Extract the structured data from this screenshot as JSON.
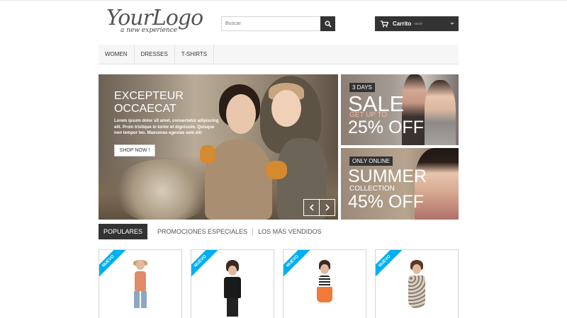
{
  "header": {
    "logo": {
      "main": "YourLogo",
      "tagline": "a new experience"
    },
    "search": {
      "placeholder": "Buscar",
      "button_icon": "search-icon"
    },
    "cart": {
      "label": "Carrito",
      "status": "vacío",
      "icon": "cart-icon"
    }
  },
  "nav": {
    "items": [
      {
        "label": "WOMEN"
      },
      {
        "label": "DRESSES"
      },
      {
        "label": "T-SHIRTS"
      }
    ]
  },
  "slider": {
    "title": "EXCEPTEUR OCCAECAT",
    "text": "Lorem ipsum dolor sit amet, consectetur adipiscing elit. Proin tristique in tortor et dignissim. Quisque non tempor leo. Maecenas egestas sem elit",
    "button": "SHOP NOW !",
    "prev_icon": "chevron-left-icon",
    "next_icon": "chevron-right-icon"
  },
  "banners": [
    {
      "tag": "3 DAYS",
      "line1": "SALE",
      "line2": "GET UP TO",
      "line3": "25% OFF"
    },
    {
      "tag": "ONLY ONLINE",
      "line1": "SUMMER",
      "line2": "COLLECTION",
      "line3": "45% OFF"
    }
  ],
  "tabs": [
    {
      "label": "POPULARES",
      "active": true
    },
    {
      "label": "PROMOCIONES ESPECIALES",
      "active": false
    },
    {
      "label": "LOS MÁS VENDIDOS",
      "active": false
    }
  ],
  "products": [
    {
      "badge": "NUEVO"
    },
    {
      "badge": "NUEVO"
    },
    {
      "badge": "NUEVO"
    },
    {
      "badge": "NUEVO"
    }
  ],
  "colors": {
    "dark": "#333333",
    "accent": "#00aff0",
    "nav_bg": "#f6f6f6",
    "banner_pink": "#f2b8a2"
  }
}
